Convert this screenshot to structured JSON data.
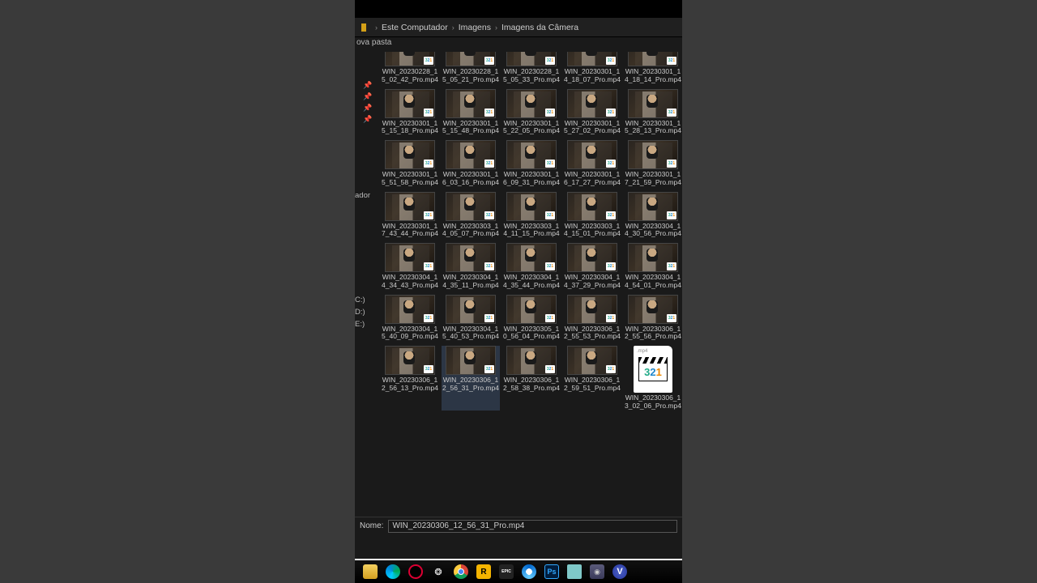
{
  "breadcrumb": {
    "seg1": "Este Computador",
    "seg2": "Imagens",
    "seg3": "Imagens da Câmera"
  },
  "toolbar": {
    "newfolder": "ova pasta"
  },
  "sidebar": {
    "frag_ador": "ador",
    "drive_c": "C:)",
    "drive_d": "D:)",
    "drive_e": "E:)"
  },
  "nome_label": "Nome:",
  "nome_value": "WIN_20230306_12_56_31_Pro.mp4",
  "mpc_ext": ".mp4",
  "files": [
    {
      "l1": "WIN_20230228_1",
      "l2": "5_02_42_Pro.mp4",
      "partial": true
    },
    {
      "l1": "WIN_20230228_1",
      "l2": "5_05_21_Pro.mp4",
      "partial": true
    },
    {
      "l1": "WIN_20230228_1",
      "l2": "5_05_33_Pro.mp4",
      "partial": true
    },
    {
      "l1": "WIN_20230301_1",
      "l2": "4_18_07_Pro.mp4",
      "partial": true
    },
    {
      "l1": "WIN_20230301_1",
      "l2": "4_18_14_Pro.mp4",
      "partial": true
    },
    {
      "l1": "WIN_20230301_1",
      "l2": "5_15_18_Pro.mp4"
    },
    {
      "l1": "WIN_20230301_1",
      "l2": "5_15_48_Pro.mp4"
    },
    {
      "l1": "WIN_20230301_1",
      "l2": "5_22_05_Pro.mp4"
    },
    {
      "l1": "WIN_20230301_1",
      "l2": "5_27_02_Pro.mp4"
    },
    {
      "l1": "WIN_20230301_1",
      "l2": "5_28_13_Pro.mp4"
    },
    {
      "l1": "WIN_20230301_1",
      "l2": "5_51_58_Pro.mp4"
    },
    {
      "l1": "WIN_20230301_1",
      "l2": "6_03_16_Pro.mp4"
    },
    {
      "l1": "WIN_20230301_1",
      "l2": "6_09_31_Pro.mp4"
    },
    {
      "l1": "WIN_20230301_1",
      "l2": "6_17_27_Pro.mp4"
    },
    {
      "l1": "WIN_20230301_1",
      "l2": "7_21_59_Pro.mp4"
    },
    {
      "l1": "WIN_20230301_1",
      "l2": "7_43_44_Pro.mp4"
    },
    {
      "l1": "WIN_20230303_1",
      "l2": "4_05_07_Pro.mp4"
    },
    {
      "l1": "WIN_20230303_1",
      "l2": "4_11_15_Pro.mp4"
    },
    {
      "l1": "WIN_20230303_1",
      "l2": "4_15_01_Pro.mp4"
    },
    {
      "l1": "WIN_20230304_1",
      "l2": "4_30_56_Pro.mp4"
    },
    {
      "l1": "WIN_20230304_1",
      "l2": "4_34_43_Pro.mp4"
    },
    {
      "l1": "WIN_20230304_1",
      "l2": "4_35_11_Pro.mp4"
    },
    {
      "l1": "WIN_20230304_1",
      "l2": "4_35_44_Pro.mp4"
    },
    {
      "l1": "WIN_20230304_1",
      "l2": "4_37_29_Pro.mp4"
    },
    {
      "l1": "WIN_20230304_1",
      "l2": "4_54_01_Pro.mp4"
    },
    {
      "l1": "WIN_20230304_1",
      "l2": "5_40_09_Pro.mp4"
    },
    {
      "l1": "WIN_20230304_1",
      "l2": "5_40_53_Pro.mp4"
    },
    {
      "l1": "WIN_20230305_1",
      "l2": "0_56_04_Pro.mp4"
    },
    {
      "l1": "WIN_20230306_1",
      "l2": "2_55_53_Pro.mp4"
    },
    {
      "l1": "WIN_20230306_1",
      "l2": "2_55_56_Pro.mp4"
    },
    {
      "l1": "WIN_20230306_1",
      "l2": "2_56_13_Pro.mp4"
    },
    {
      "l1": "WIN_20230306_1",
      "l2": "2_56_31_Pro.mp4",
      "selected": true
    },
    {
      "l1": "WIN_20230306_1",
      "l2": "2_58_38_Pro.mp4"
    },
    {
      "l1": "WIN_20230306_1",
      "l2": "2_59_51_Pro.mp4"
    },
    {
      "l1": "WIN_20230306_1",
      "l2": "3_02_06_Pro.mp4",
      "mpc": true
    }
  ],
  "taskbar_icons": [
    "file-explorer",
    "edge",
    "opera-gx",
    "steam",
    "chrome",
    "rockstar",
    "epic-games",
    "ubisoft",
    "photoshop",
    "app-teal",
    "camera",
    "app-v"
  ]
}
